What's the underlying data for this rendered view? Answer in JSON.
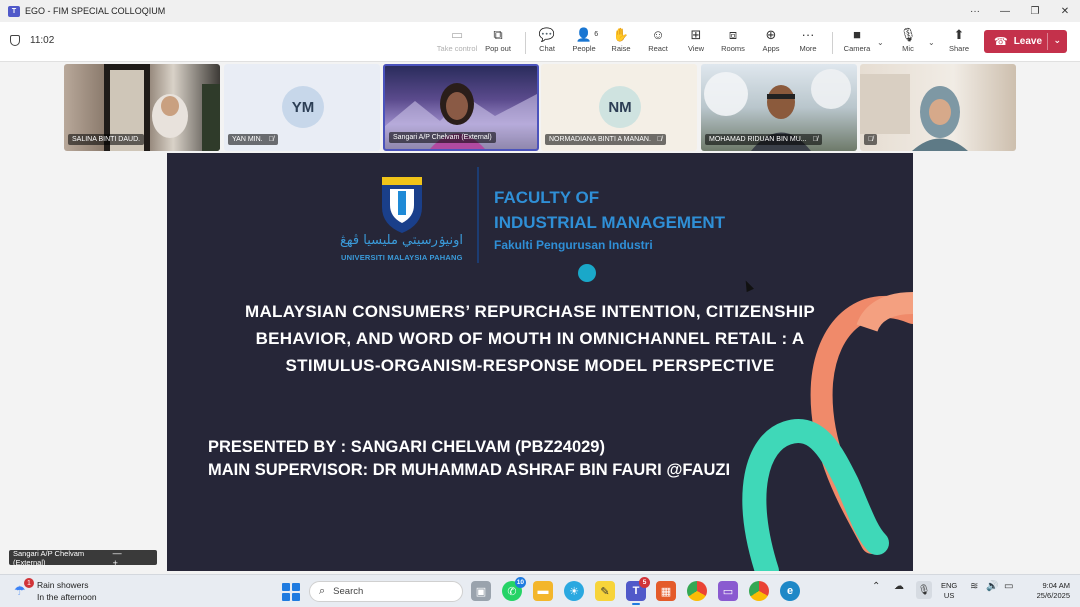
{
  "window": {
    "title": "EGO - FIM SPECIAL COLLOQIUM",
    "controls": {
      "more": "···",
      "minimize": "—",
      "restore": "❐",
      "close": "✕"
    }
  },
  "toolbar": {
    "timer": "11:02",
    "buttons": {
      "take_control": "Take control",
      "pop_out": "Pop out",
      "chat": "Chat",
      "people": "People",
      "people_count": "6",
      "raise": "Raise",
      "react": "React",
      "view": "View",
      "rooms": "Rooms",
      "apps": "Apps",
      "more": "More",
      "camera": "Camera",
      "mic": "Mic",
      "share": "Share"
    },
    "leave_label": "Leave"
  },
  "participants": [
    {
      "name": "SALINA BINTI DAUD.",
      "initials": "",
      "muted": false
    },
    {
      "name": "YAN MIN.",
      "initials": "YM",
      "muted": true
    },
    {
      "name": "Sangari A/P Chelvam (External)",
      "initials": "",
      "muted": false,
      "active_speaker": true
    },
    {
      "name": "NORMADIANA BINTI A MANAN.",
      "initials": "NM",
      "muted": true
    },
    {
      "name": "MOHAMAD RIDUAN BIN MU...",
      "initials": "",
      "muted": true
    },
    {
      "name": "",
      "initials": "",
      "muted": true
    }
  ],
  "slide": {
    "university_arabic": "اونيۏرسيتي مليسيا ڤهڠ",
    "university_name": "UNIVERSITI MALAYSIA PAHANG",
    "logo_text": "UMP",
    "faculty_line1": "FACULTY OF",
    "faculty_line2": "INDUSTRIAL MANAGEMENT",
    "faculty_malay": "Fakulti Pengurusan Industri",
    "title_lines": [
      "MALAYSIAN CONSUMERS’ REPURCHASE INTENTION, CITIZENSHIP",
      "BEHAVIOR, AND WORD OF MOUTH IN OMNICHANNEL RETAIL : A",
      "STIMULUS-ORGANISM-RESPONSE MODEL PERSPECTIVE"
    ],
    "presented_by": "PRESENTED BY : SANGARI CHELVAM (PBZ24029)",
    "supervisor": "MAIN SUPERVISOR: DR MUHAMMAD ASHRAF BIN FAURI @FAUZI"
  },
  "self_view": {
    "label": "Sangari A/P Chelvam (External)",
    "controls": "— +"
  },
  "taskbar": {
    "weather_badge": "1",
    "weather_line1": "Rain showers",
    "weather_line2": "In the afternoon",
    "search_placeholder": "Search",
    "whatsapp_badge": "10",
    "teams_badge": "5",
    "lang_line1": "ENG",
    "lang_line2": "US",
    "time": "9:04 AM",
    "date": "25/6/2025"
  },
  "colors": {
    "leave": "#c4314b",
    "slide_bg": "#262638",
    "faculty_blue": "#2f8fd6",
    "ribbon_orange": "#f08a6a",
    "ribbon_teal": "#3fd8b8"
  }
}
